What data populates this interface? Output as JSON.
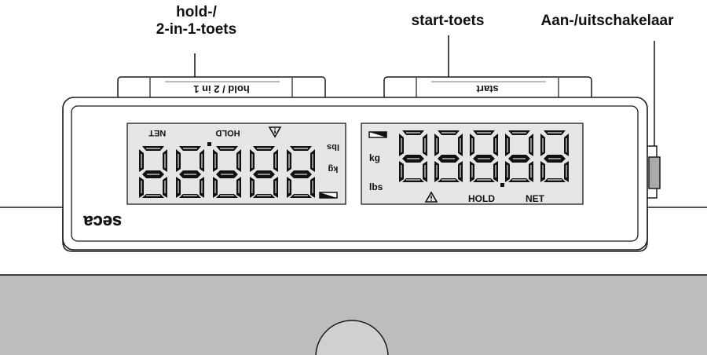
{
  "callouts": {
    "hold_line1": "hold-/",
    "hold_line2": "2-in-1-toets",
    "start": "start-toets",
    "power": "Aan-/uitschakelaar"
  },
  "buttons": {
    "hold_label": "hold / 2 in 1",
    "start_label": "start"
  },
  "display_left": {
    "net": "NET",
    "hold": "HOLD",
    "lbs": "lbs",
    "kg": "kg",
    "digits": "88888"
  },
  "display_right": {
    "kg": "kg",
    "lbs": "lbs",
    "hold": "HOLD",
    "net": "NET",
    "digits": "888.88"
  },
  "brand": "seca",
  "colors": {
    "lcd_background": "#e6e6e6",
    "housing": "#ffffff",
    "base": "#bdbdbd",
    "outline": "#1a1a1a"
  }
}
